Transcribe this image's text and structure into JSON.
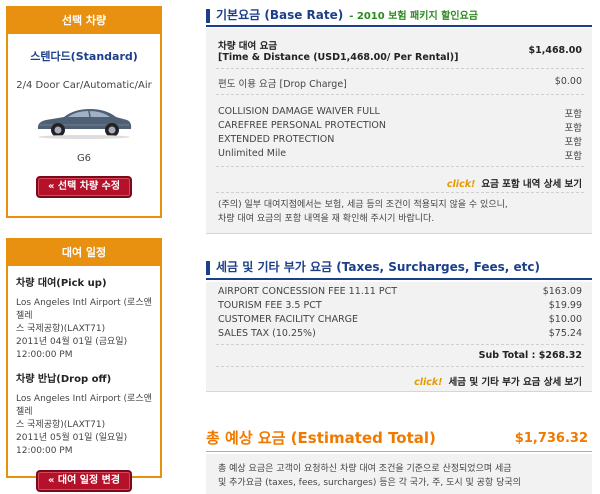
{
  "vehicle": {
    "header": "선택 차량",
    "class_name": "스텐다드(Standard)",
    "description": "2/4 Door Car/Automatic/Air",
    "model": "G6",
    "edit_button": "« 선택 차량 수정"
  },
  "schedule": {
    "header": "대여 일정",
    "pickup_title": "차량 대여(Pick up)",
    "pickup_location_1": "Los Angeles Intl Airport (로스앤젤레",
    "pickup_location_2": "스 국제공항)(LAXT71)",
    "pickup_date": "2011년 04월 01일 (금요일)",
    "pickup_time": "12:00:00 PM",
    "dropoff_title": "차량 반납(Drop off)",
    "dropoff_location_1": "Los Angeles Intl Airport (로스앤젤레",
    "dropoff_location_2": "스 국제공항)(LAXT71)",
    "dropoff_date": "2011년 05월 01일 (일요일)",
    "dropoff_time": "12:00:00 PM",
    "change_button": "« 대여 일정 변경"
  },
  "base_rate": {
    "title": "기본요금 (Base Rate)",
    "promo": "- 2010 보험 패키지 할인요금",
    "rental_label_1": "차량 대여 요금",
    "rental_label_2": "[Time & Distance (USD1,468.00/ Per Rental)]",
    "rental_value": "$1,468.00",
    "drop_label": "편도 이용 요금 [Drop Charge]",
    "drop_value": "$0.00",
    "included": [
      {
        "label": "COLLISION DAMAGE WAIVER FULL",
        "value": "포함"
      },
      {
        "label": "CAREFREE PERSONAL PROTECTION",
        "value": "포함"
      },
      {
        "label": "EXTENDED PROTECTION",
        "value": "포함"
      },
      {
        "label": "Unlimited Mile",
        "value": "포함"
      }
    ],
    "click": "click!",
    "detail_link": "요금 포함 내역 상세 보기",
    "note_1": "(주의) 일부 대여지점에서는 보험, 세금 등의 조건이 적용되지 않을 수 있으니,",
    "note_2": "차량 대여 요금의 포함 내역을 재 확인해 주시기 바랍니다."
  },
  "taxes": {
    "title": "세금 및 기타 부가 요금 (Taxes, Surcharges, Fees, etc)",
    "items": [
      {
        "label": "AIRPORT CONCESSION FEE 11.11 PCT",
        "value": "$163.09"
      },
      {
        "label": "TOURISM FEE 3.5 PCT",
        "value": "$19.99"
      },
      {
        "label": "CUSTOMER FACILITY CHARGE",
        "value": "$10.00"
      },
      {
        "label": "SALES TAX (10.25%)",
        "value": "$75.24"
      }
    ],
    "subtotal": "Sub Total : $268.32",
    "click": "click!",
    "detail_link": "세금 및 기타 부가 요금 상세 보기"
  },
  "total": {
    "title": "총 예상 요금 (Estimated Total)",
    "value": "$1,736.32",
    "note_1": "총 예상 요금은 고객이 요청하신 차량 대여 조건을 기준으로 산정되었으며 세금",
    "note_2": "및 추가요금 (taxes, fees, surcharges) 등은 각 국가, 주, 도시 및 공항 당국의"
  },
  "colors": {
    "accent_orange": "#e8900f",
    "navy": "#1d3f8a",
    "button_red": "#b3122a",
    "promo_green": "#2b8a1e"
  }
}
